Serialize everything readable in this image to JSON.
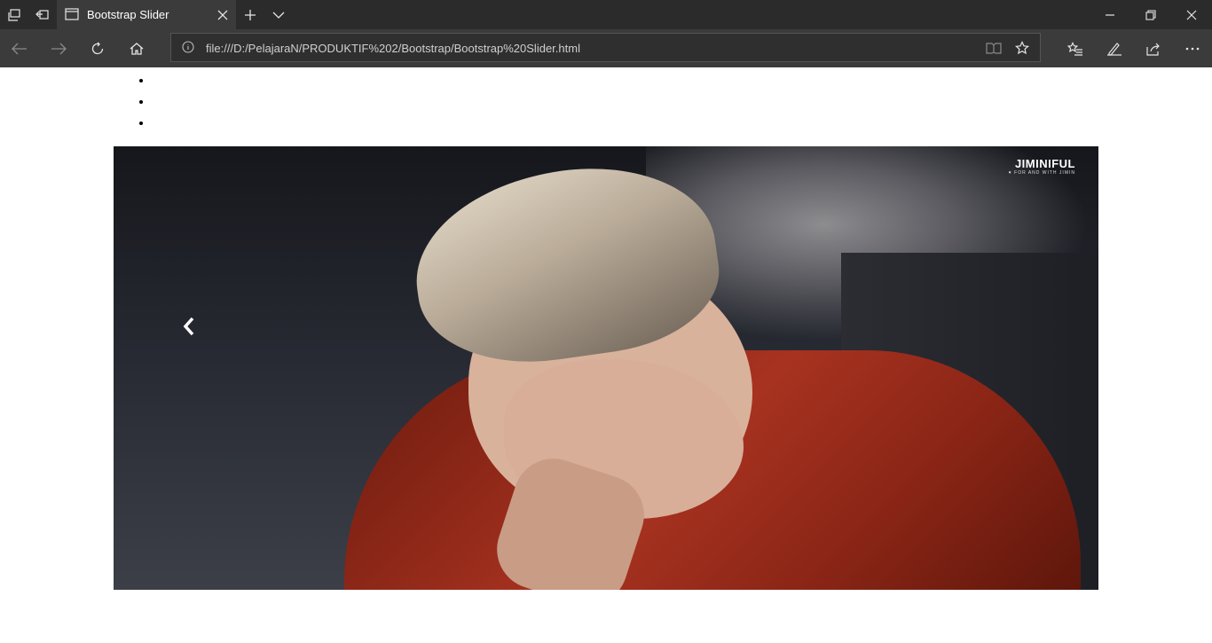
{
  "browser": {
    "tab": {
      "title": "Bootstrap Slider"
    },
    "address": {
      "url": "file:///D:/PelajaraN/PRODUKTIF%202/Bootstrap/Bootstrap%20Slider.html"
    },
    "icons": [
      "tab-overview-icon",
      "set-aside-tabs-icon",
      "tab-page-icon",
      "close-icon",
      "new-tab-icon",
      "tab-preview-chevron-icon",
      "minimize-icon",
      "restore-icon",
      "window-close-icon",
      "back-icon",
      "forward-icon",
      "refresh-icon",
      "home-icon",
      "info-icon",
      "reading-view-icon",
      "favorite-star-icon",
      "favorites-hub-icon",
      "notes-pen-icon",
      "share-icon",
      "more-icon"
    ]
  },
  "page": {
    "indicators": [
      "",
      "",
      ""
    ],
    "slide": {
      "watermark": {
        "main": "JIMINIFUL",
        "sub": "♥ FOR AND WITH JIMIN"
      }
    }
  },
  "colors": {
    "tabbar": "#2b2b2b",
    "navbar": "#3b3b3b",
    "address": "#2f2f2f",
    "page": "#ffffff"
  }
}
